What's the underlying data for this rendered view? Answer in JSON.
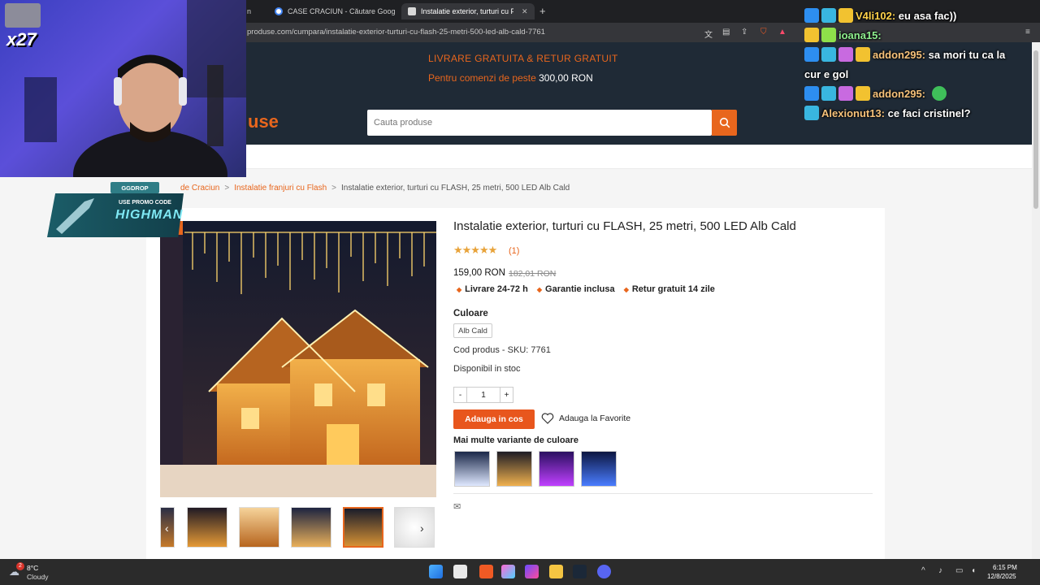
{
  "browser": {
    "tabs": [
      {
        "label": "n",
        "active": false
      },
      {
        "label": "CASE CRACIUN - Căutare Google",
        "active": false
      },
      {
        "label": "Instalatie exterior, turturi cu FLA",
        "active": true
      }
    ],
    "new_tab": "+",
    "tab_close": "✕",
    "url": "produse.com/cumpara/instalatie-exterior-turturi-cu-flash-25-metri-500-led-alb-cald-7761"
  },
  "header": {
    "shipping_line1": "LIVRARE GRATUITA & RETUR GRATUIT",
    "shipping_line2_prefix": "Pentru comenzi de peste",
    "shipping_line2_amount": "300,00 RON",
    "logo_text": "use",
    "search_placeholder": "Cauta produse"
  },
  "breadcrumb": {
    "items": [
      "de Craciun",
      "Instalatie franjuri cu Flash",
      "Instalatie exterior, turturi cu FLASH, 25 metri, 500 LED Alb Cald"
    ],
    "separator": ">"
  },
  "product": {
    "title": "Instalatie exterior, turturi cu FLASH, 25 metri, 500 LED Alb Cald",
    "stars": "★★★★★",
    "rating": 5,
    "reviews": "(1)",
    "price": "159,00 RON",
    "old_price": "182,01 RON",
    "perks": [
      "Livrare 24-72 h",
      "Garantie inclusa",
      "Retur gratuit 14 zile"
    ],
    "perk_bullet": "◆",
    "color_label": "Culoare",
    "color_value": "Alb Cald",
    "sku": "Cod produs - SKU: 7761",
    "stock": "Disponibil in stoc",
    "qty_minus": "-",
    "qty_value": "1",
    "qty_plus": "+",
    "add_to_cart": "Adauga in cos",
    "favorite": "Adauga la Favorite",
    "variants_label": "Mai multe variante de culoare"
  },
  "gallery": {
    "prev": "‹",
    "next": "›"
  },
  "taskbar": {
    "weather_temp": "8°C",
    "weather_desc": "Cloudy",
    "weather_badge": "2",
    "time": "6:15 PM",
    "date": "12/8/2025"
  },
  "overlay": {
    "webcam_multiplier": "x27",
    "promo_brand": "GGDROP",
    "promo_text": "USE PROMO CODE",
    "promo_code": "HIGHMAN"
  },
  "chat": [
    {
      "user": "V4li102:",
      "message": "eu asa fac))",
      "user_color": "#ffd24a"
    },
    {
      "user": "ioana15:",
      "message": "",
      "user_color": "#8ef08e"
    },
    {
      "user": "addon295:",
      "message": "sa mori tu ca la cur e gol",
      "user_color": "#f7c27a"
    },
    {
      "user": "addon295:",
      "message": "",
      "user_color": "#f7c27a"
    },
    {
      "user": "Alexionut13:",
      "message": "ce faci cristinel?",
      "user_color": "#f7c27a"
    }
  ],
  "colors": {
    "accent": "#e8661d",
    "header_bg": "#1f2a36"
  }
}
